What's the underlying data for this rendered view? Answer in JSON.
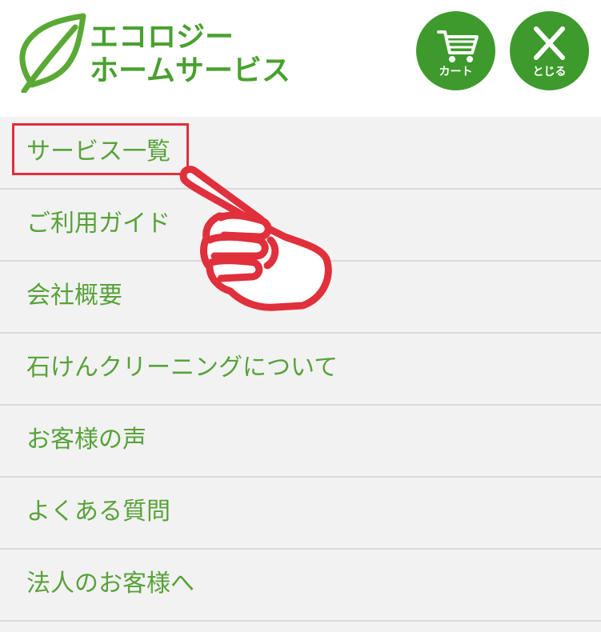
{
  "brand": {
    "line1": "エコロジー",
    "line2": "ホームサービス",
    "color": "#4aa02f"
  },
  "header": {
    "cart_label": "カート",
    "close_label": "とじる",
    "button_color": "#3e9a2c"
  },
  "menu": {
    "text_color": "#58a23a",
    "items": [
      {
        "label": "サービス一覧",
        "highlighted": true
      },
      {
        "label": "ご利用ガイド"
      },
      {
        "label": "会社概要"
      },
      {
        "label": "石けんクリーニングについて"
      },
      {
        "label": "お客様の声"
      },
      {
        "label": "よくある質問"
      },
      {
        "label": "法人のお客様へ"
      }
    ]
  },
  "annotation": {
    "highlight_color": "#e0303c",
    "pointer": "pointing-hand-icon"
  }
}
